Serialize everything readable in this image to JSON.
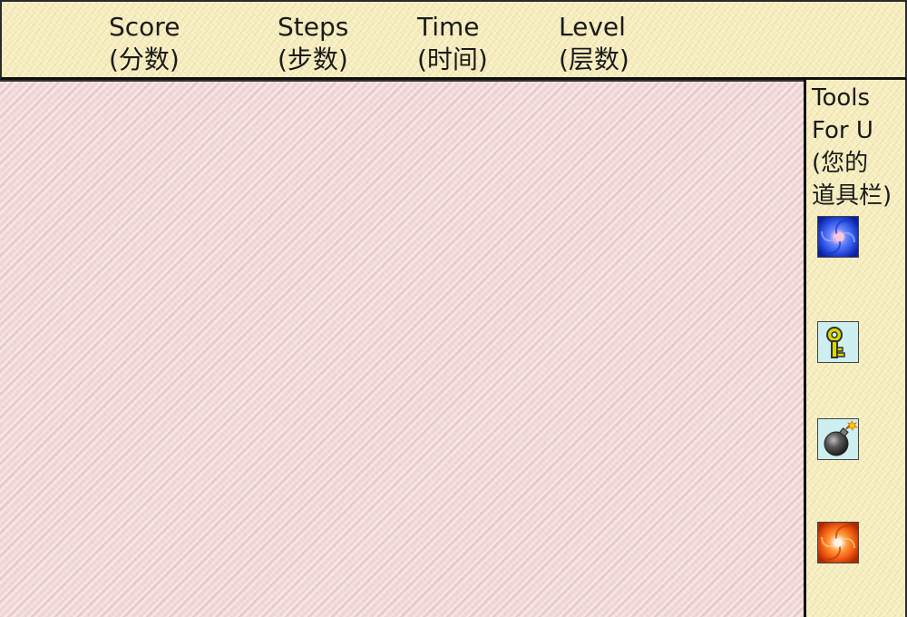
{
  "header": {
    "score": {
      "label": "Score",
      "label_cn": "(分数)"
    },
    "steps": {
      "label": "Steps",
      "label_cn": "(步数)"
    },
    "time": {
      "label": "Time",
      "label_cn": "(时间)"
    },
    "level": {
      "label": "Level",
      "label_cn": "(层数)"
    }
  },
  "tools_panel": {
    "title_line1": "Tools",
    "title_line2": "For U",
    "title_line3": "(您的",
    "title_line4": "道具栏)",
    "items": [
      {
        "icon": "blue-portal-icon"
      },
      {
        "icon": "key-icon"
      },
      {
        "icon": "bomb-icon"
      },
      {
        "icon": "orange-portal-icon"
      }
    ]
  },
  "colors": {
    "header_bg": "#f7eebd",
    "play_field_bg": "#f1d6d6",
    "border": "#111111",
    "blue_portal": "#2a4fe0",
    "orange_portal": "#f05a12",
    "key": "#d8d800",
    "bomb": "#444444",
    "tool_bg": "#cdeff0"
  }
}
